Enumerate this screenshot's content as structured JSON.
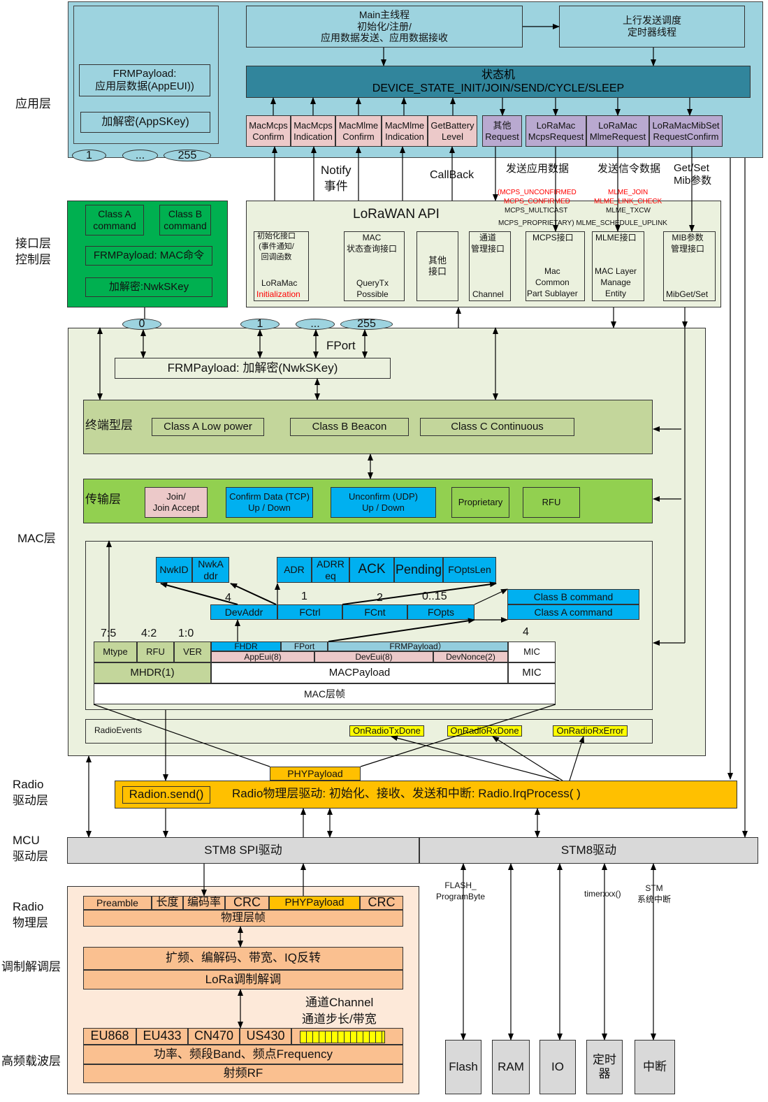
{
  "layers": {
    "app": "应用层",
    "iface": "接口层\n控制层",
    "mac": "MAC层",
    "radio_drv": "Radio\n驱动层",
    "mcu": "MCU\n驱动层",
    "radio_phy": "Radio\n物理层",
    "modem": "调制解调层",
    "rf": "高频载波层"
  },
  "app": {
    "frm": "FRMPayload:\n应用层数据(AppEUI))",
    "crypt": "加解密(AppSKey)",
    "e1": "1",
    "e2": "...",
    "e3": "255",
    "main": "Main主线程\n初始化/注册/\n应用数据发送、应用数据接收",
    "uplink": "上行发送调度\n定时器线程",
    "fsm": "状态机\nDEVICE_STATE_INIT/JOIN/SEND/CYCLE/SLEEP",
    "cb": [
      "MacMcps\nConfirm",
      "MacMcps\nIndication",
      "MacMlme\nConfirm",
      "MacMlme\nIndication",
      "GetBattery\nLevel"
    ],
    "req": [
      "其他\nRequest",
      "LoRaMac\nMcpsRequest",
      "LoRaMac\nMlmeRequest",
      "LoRaMacMibSet\nRequestConfirm"
    ]
  },
  "iface": {
    "classA": "Class A\ncommand",
    "classB": "Class B\ncommand",
    "frm": "FRMPayload: MAC命令",
    "crypt": "加解密:NwkSKey",
    "notify": "Notify\n事件",
    "callback": "CallBack",
    "send_app": "发送应用数据",
    "send_sig": "发送信令数据",
    "getset": "Get/Set\nMib参数",
    "mcps_red": "(MCPS_UNCONFIRMED\nMCPS_CONFIRMED",
    "mcps_black": "MCPS_MULTICAST",
    "mlme_red": "MLME_JOIN\nMLME_LINK_CHECK",
    "mlme_black": "MLME_TXCW",
    "bottom_line": "MCPS_PROPRIETARY) MLME_SCHEDULE_UPLINK",
    "api_title": "LoRaWAN API",
    "init_top": "初始化接口\n(事件通知/\n回调函数",
    "init_b1": "LoRaMac",
    "init_b2": "Initialization",
    "mac_top": "MAC\n状态查询接口",
    "mac_b": "QueryTx\nPossible",
    "other": "其他\n接口",
    "chan_top": "通道\n管理接口",
    "chan_b": "Channel",
    "mcps_top": "MCPS接口",
    "mcps_b": "Mac\nCommon\nPart Sublayer",
    "mlme_top": "MLME接口",
    "mlme_b": "MAC Layer\nManage\nEntity",
    "mib_top": "MIB参数\n管理接口",
    "mib_b": "MibGet/Set"
  },
  "mac": {
    "p0": "0",
    "p1": "1",
    "p2": "...",
    "p3": "255",
    "fport": "FPort",
    "frm": "FRMPayload: 加解密(NwkSKey)",
    "class_label": "终端型层",
    "classA": "Class A  Low power",
    "classB": "Class B Beacon",
    "classC": "Class C Continuous",
    "trans_label": "传输层",
    "join": "Join/\nJoin Accept",
    "confirm": "Confirm Data (TCP)\nUp / Down",
    "unconfirm": "Unconfirm (UDP)\nUp /  Down",
    "prop": "Proprietary",
    "rfu": "RFU",
    "nwkid": "NwkID",
    "nwkaddr": "NwkA\nddr",
    "adr": "ADR",
    "adrreq": "ADRR\neq",
    "ack": "ACK",
    "pending": "Pending",
    "foptslen": "FOptsLen",
    "n4": "4",
    "n1": "1",
    "n2": "2",
    "n015": "0..15",
    "devaddr": "DevAddr",
    "fctrl": "FCtrl",
    "fcnt": "FCnt",
    "fopts": "FOpts",
    "classBcmd": "Class B command",
    "classAcmd": "Class A command",
    "b75": "7:5",
    "b42": "4:2",
    "b10": "1:0",
    "mic4": "4",
    "mtype": "Mtype",
    "rfu2": "RFU",
    "ver": "VER",
    "fhdr": "FHDR",
    "fport2": "FPort",
    "frmp": "FRMPayload）",
    "appeui": "AppEui(8)",
    "deveui": "DevEui(8)",
    "devnonce": "DevNonce(2)",
    "mic": "MIC",
    "mhdr": "MHDR(1)",
    "macpayload": "MACPayload",
    "mic2": "MIC",
    "macframe": "MAC层帧",
    "radioevents": "RadioEvents",
    "txdone": "OnRadioTxDone",
    "rxdone": "OnRadioRxDone",
    "rxerror": "OnRadioRxError"
  },
  "radio": {
    "phypayload": "PHYPayload",
    "send": "Radion.send()",
    "desc": "Radio物理层驱动: 初始化、接收、发送和中断:  Radio.IrqProcess( )"
  },
  "mcu": {
    "spi": "STM8 SPI驱动",
    "drv": "STM8驱动",
    "flash_lbl": "FLASH_\nProgramByte",
    "timer_lbl": "timerxxx()",
    "stm_lbl": "STM\n系统中断",
    "flash": "Flash",
    "ram": "RAM",
    "io": "IO",
    "timer": "定时\n器",
    "irq": "中断"
  },
  "phy": {
    "preamble": "Preamble",
    "len": "长度",
    "cr": "编码率",
    "crc1": "CRC",
    "phypayload": "PHYPayload",
    "crc2": "CRC",
    "frame": "物理层帧",
    "spread": "扩频、编解码、带宽、IQ反转",
    "lora": "LoRa调制解调",
    "channel": "通道Channel",
    "step": "通道步长/带宽",
    "eu868": "EU868",
    "eu433": "EU433",
    "cn470": "CN470",
    "us430": "US430",
    "power": "功率、频段Band、频点Frequency",
    "rf": "射频RF"
  },
  "colors": {
    "app": "#9dd3df",
    "fsm": "#31859c",
    "iface": "#00b050",
    "mac_bg": "#ebf1de",
    "class": "#c3d69b",
    "trans": "#92d050",
    "blue": "#00b0f0",
    "radio": "#ffc000",
    "mcu": "#d9d9d9",
    "phy_bg": "#fde9d9",
    "phy_box": "#fac090"
  }
}
